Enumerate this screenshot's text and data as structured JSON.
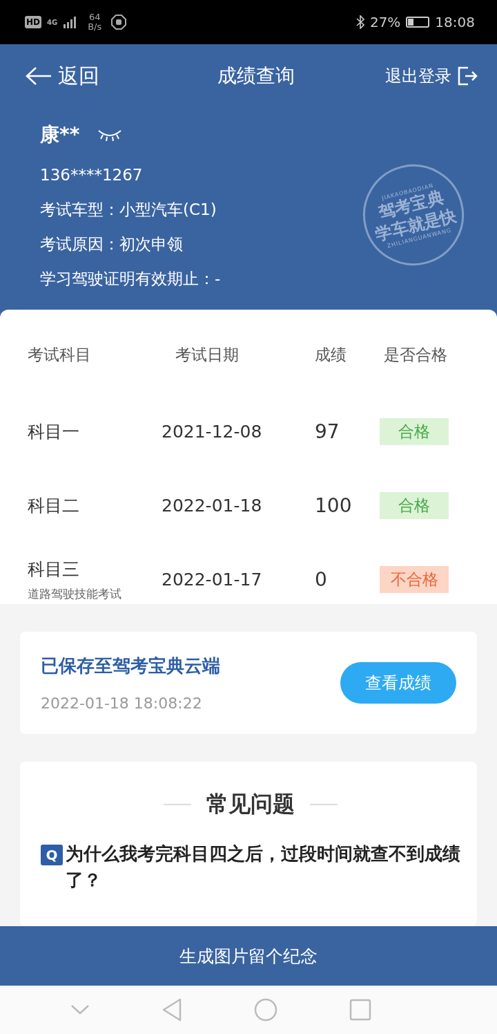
{
  "status_bar": {
    "hd": "HD",
    "network": "4G",
    "speed_value": "64",
    "speed_unit": "B/s",
    "battery": "27%",
    "time": "18:08"
  },
  "header": {
    "back": "返回",
    "title": "成绩查询",
    "logout": "退出登录"
  },
  "profile": {
    "name": "康**",
    "phone": "136****1267",
    "lines": [
      {
        "label": "考试车型：",
        "value": "小型汽车(C1)"
      },
      {
        "label": "考试原因：",
        "value": "初次申领"
      },
      {
        "label": "学习驾驶证明有效期止：",
        "value": "-"
      }
    ],
    "stamp": {
      "top": "JIAKAOBAODIAN",
      "line1": "驾考宝典",
      "line2": "学车就是快",
      "bottom": "ZHILIANGUANWANG"
    }
  },
  "table": {
    "columns": [
      "考试科目",
      "考试日期",
      "成绩",
      "是否合格"
    ],
    "rows": [
      {
        "subject": "科目一",
        "date": "2021-12-08",
        "score": "97",
        "result": "合格",
        "passed": true
      },
      {
        "subject": "科目二",
        "date": "2022-01-18",
        "score": "100",
        "result": "合格",
        "passed": true
      },
      {
        "subject": "科目三",
        "note": "道路驾驶技能考试",
        "date": "2022-01-17",
        "score": "0",
        "result": "不合格",
        "passed": false
      }
    ]
  },
  "saved": {
    "title": "已保存至驾考宝典云端",
    "time": "2022-01-18 18:08:22",
    "button": "查看成绩"
  },
  "faq": {
    "title": "常见问题",
    "questions": [
      {
        "badge": "Q",
        "text": "为什么我考完科目四之后，过段时间就查不到成绩了？"
      }
    ]
  },
  "bottom_button": "生成图片留个纪念"
}
